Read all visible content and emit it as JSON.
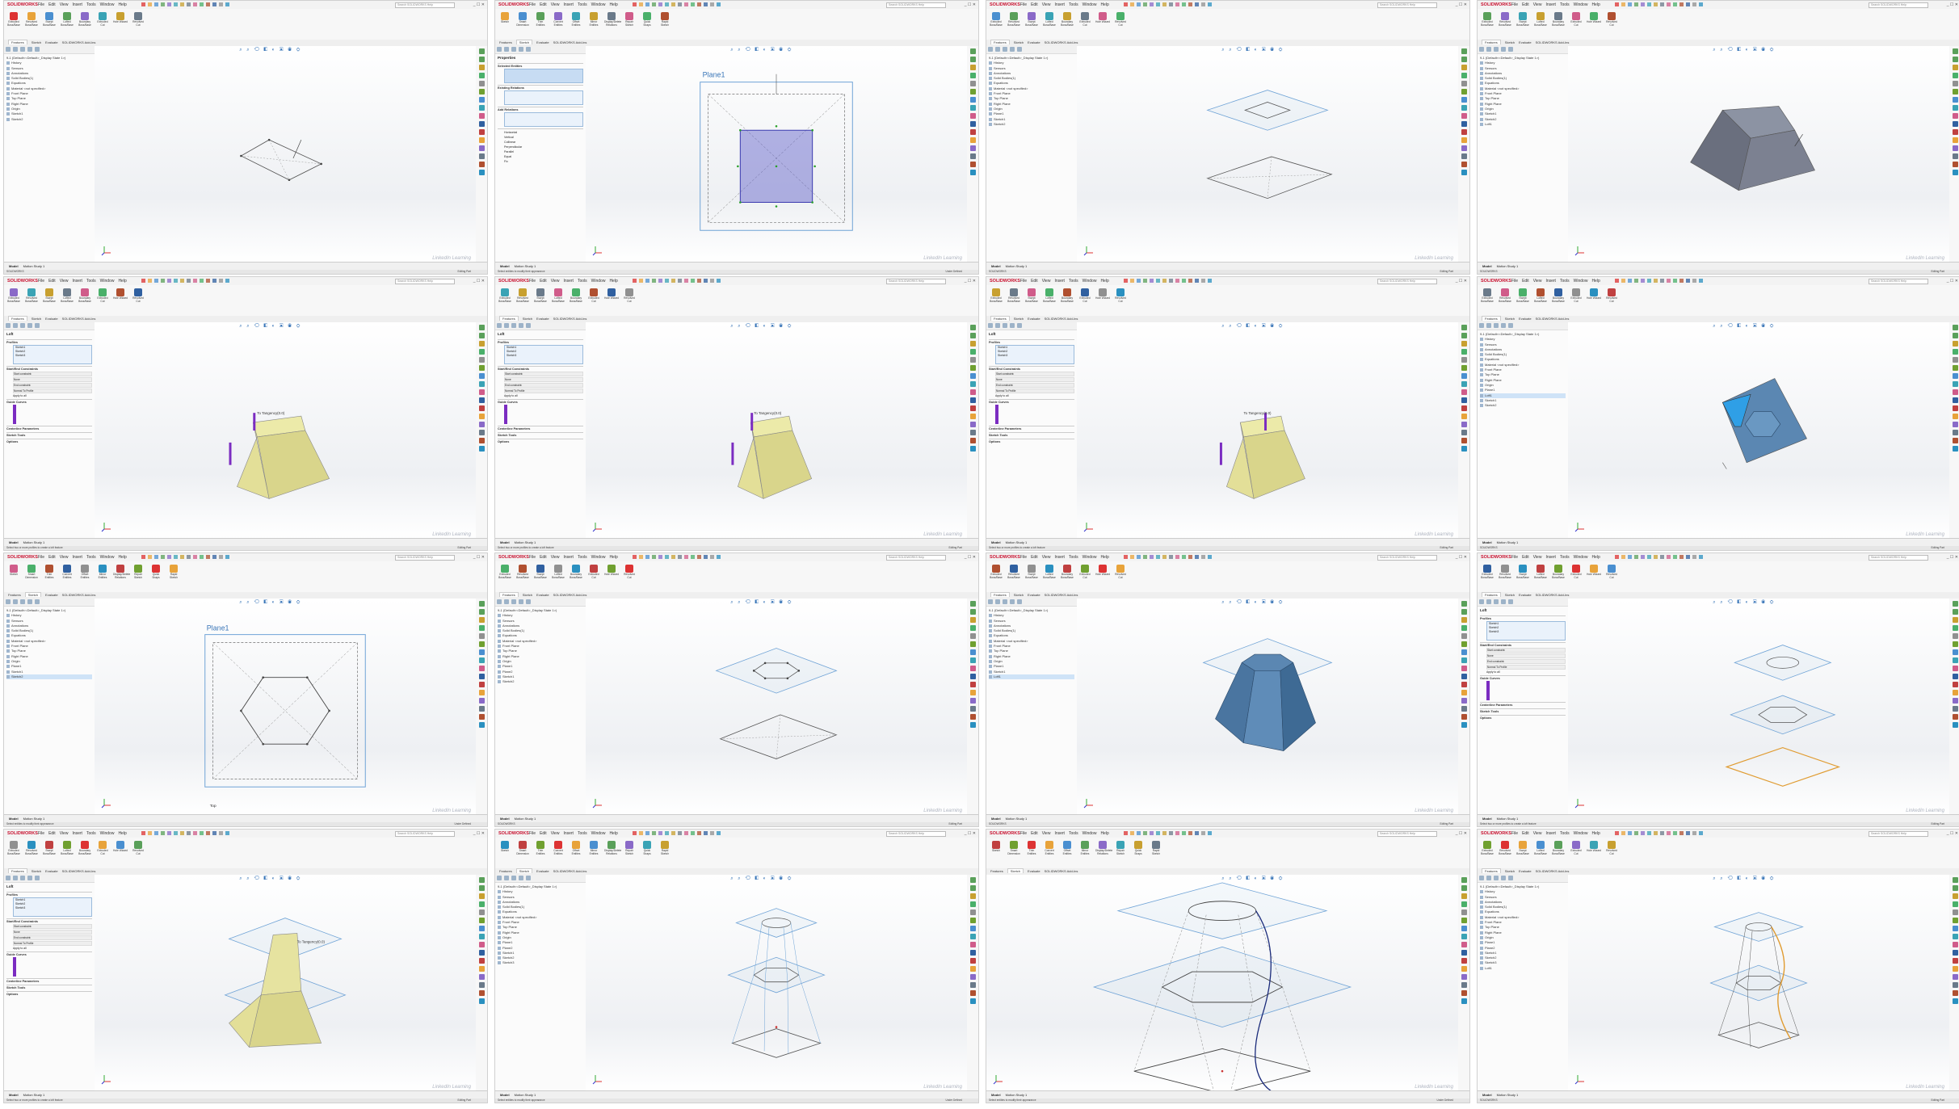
{
  "app": {
    "brand": "SOLIDWORKS",
    "menus": [
      "File",
      "Edit",
      "View",
      "Insert",
      "Tools",
      "Window",
      "Help"
    ],
    "search_placeholder": "Search SOLIDWORKS Help",
    "window_controls": "_ ☐ ✕"
  },
  "tabs": [
    "Features",
    "Sketch",
    "Evaluate",
    "SOLIDWORKS Add-Ins"
  ],
  "bottom_tabs": [
    "Model",
    "Motion Study 1"
  ],
  "watermark": "LinkedIn Learning",
  "ribbon_feature_labels": [
    "Extruded Boss/Base",
    "Revolved Boss/Base",
    "Swept Boss/Base",
    "Lofted Boss/Base",
    "Boundary Boss/Base",
    "Extruded Cut",
    "Hole Wizard",
    "Revolved Cut",
    "Fillet",
    "Linear Pattern",
    "Rib",
    "Draft",
    "Wrap",
    "Reference Geometry",
    "Curves",
    "Instant3D"
  ],
  "ribbon_sketch_labels": [
    "Sketch",
    "Smart Dimension",
    "Trim Entities",
    "Convert Entities",
    "Offset Entities",
    "Mirror Entities",
    "Display/Delete Relations",
    "Repair Sketch",
    "Quick Snaps",
    "Rapid Sketch"
  ],
  "tree_base": [
    "History",
    "Sensors",
    "Annotations",
    "Solid Bodies(1)",
    "Equations",
    "Material <not specified>",
    "Front Plane",
    "Top Plane",
    "Right Plane",
    "Origin"
  ],
  "tree_root": "9-1 (Default<<Default>_Display State 1>)",
  "pm": {
    "properties_title": "Properties",
    "loft_title": "Loft",
    "selected_entities": "Selected Entities",
    "existing_relations": "Existing Relations",
    "add_relations": "Add Relations",
    "profiles": "Profiles",
    "start_end": "Start/End Constraints",
    "guide_curves": "Guide Curves",
    "centerline": "Centerline Parameters",
    "sketch_tools": "Sketch Tools",
    "options": "Options",
    "start_constraint": "Start constraint:",
    "end_constraint": "End constraint:",
    "none": "None",
    "normal_profile": "Normal To Profile",
    "apply_all": "Apply to all",
    "merge": "Merge tangent faces",
    "close_loft": "Close loft",
    "show_preview": "Show preview",
    "micro": "Micro tolerance",
    "fully_defined": "Under Defined",
    "relations": [
      "Horizontal",
      "Vertical",
      "Collinear",
      "Perpendicular",
      "Parallel",
      "Equal",
      "Fix"
    ],
    "profile_items": [
      "Sketch1",
      "Sketch2",
      "Sketch3"
    ]
  },
  "status": {
    "editing_part": "Editing Part",
    "under_defined": "Under Defined",
    "mmgs": "MMGS",
    "msg_loft": "Select two or more profiles to create a loft feature",
    "msg_sketch": "Select entities to modify their appearance",
    "msg_default": "SOLIDWORKS"
  },
  "view_labels": {
    "plane1": "Plane1",
    "top": "Top",
    "tangency": "To Tangency(0.0)"
  },
  "icons": [
    "new-icon",
    "open-icon",
    "save-icon",
    "print-icon",
    "undo-icon",
    "redo-icon",
    "rebuild-icon",
    "options-icon",
    "zoom-fit-icon",
    "zoom-area-icon",
    "view-orientation-icon",
    "display-style-icon",
    "appearance-icon",
    "scene-icon"
  ],
  "colors": {
    "accent": "#c8102e",
    "plane_blue": "#6fa3d6",
    "loft_preview": "#e6e3a0",
    "solid_blue": "#5b87b2",
    "sketch_dark": "#555555",
    "guide_purple": "#7b2cc1",
    "guide_orange": "#e09b30"
  }
}
